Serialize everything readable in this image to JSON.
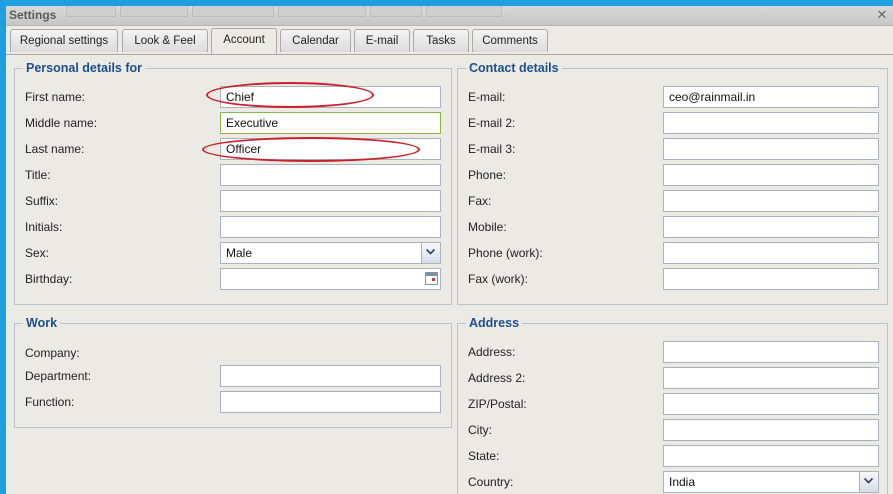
{
  "window": {
    "title": "Settings",
    "close_symbol": "✕"
  },
  "tabs": [
    {
      "label": "Regional settings"
    },
    {
      "label": "Look & Feel"
    },
    {
      "label": "Account",
      "active": true
    },
    {
      "label": "Calendar"
    },
    {
      "label": "E-mail"
    },
    {
      "label": "Tasks"
    },
    {
      "label": "Comments"
    }
  ],
  "personal": {
    "legend": "Personal details for",
    "fields": [
      {
        "label": "First name:",
        "value": "Chief"
      },
      {
        "label": "Middle name:",
        "value": "Executive"
      },
      {
        "label": "Last name:",
        "value": "Officer"
      },
      {
        "label": "Title:",
        "value": ""
      },
      {
        "label": "Suffix:",
        "value": ""
      },
      {
        "label": "Initials:",
        "value": ""
      },
      {
        "label": "Sex:",
        "value": "Male"
      },
      {
        "label": "Birthday:",
        "value": ""
      }
    ]
  },
  "contact": {
    "legend": "Contact details",
    "fields": [
      {
        "label": "E-mail:",
        "value": "ceo@rainmail.in"
      },
      {
        "label": "E-mail 2:",
        "value": ""
      },
      {
        "label": "E-mail 3:",
        "value": ""
      },
      {
        "label": "Phone:",
        "value": ""
      },
      {
        "label": "Fax:",
        "value": ""
      },
      {
        "label": "Mobile:",
        "value": ""
      },
      {
        "label": "Phone (work):",
        "value": ""
      },
      {
        "label": "Fax (work):",
        "value": ""
      }
    ]
  },
  "work": {
    "legend": "Work",
    "fields": [
      {
        "label": "Company:"
      },
      {
        "label": "Department:",
        "value": ""
      },
      {
        "label": "Function:",
        "value": ""
      }
    ]
  },
  "address": {
    "legend": "Address",
    "fields": [
      {
        "label": "Address:",
        "value": ""
      },
      {
        "label": "Address 2:",
        "value": ""
      },
      {
        "label": "ZIP/Postal:",
        "value": ""
      },
      {
        "label": "City:",
        "value": ""
      },
      {
        "label": "State:",
        "value": ""
      },
      {
        "label": "Country:",
        "value": "India"
      }
    ]
  },
  "colors": {
    "frame": "#1ea0e0",
    "legend": "#1e4f8a",
    "annotation": "#cc1f2a",
    "focus_border": "#8eb346"
  }
}
